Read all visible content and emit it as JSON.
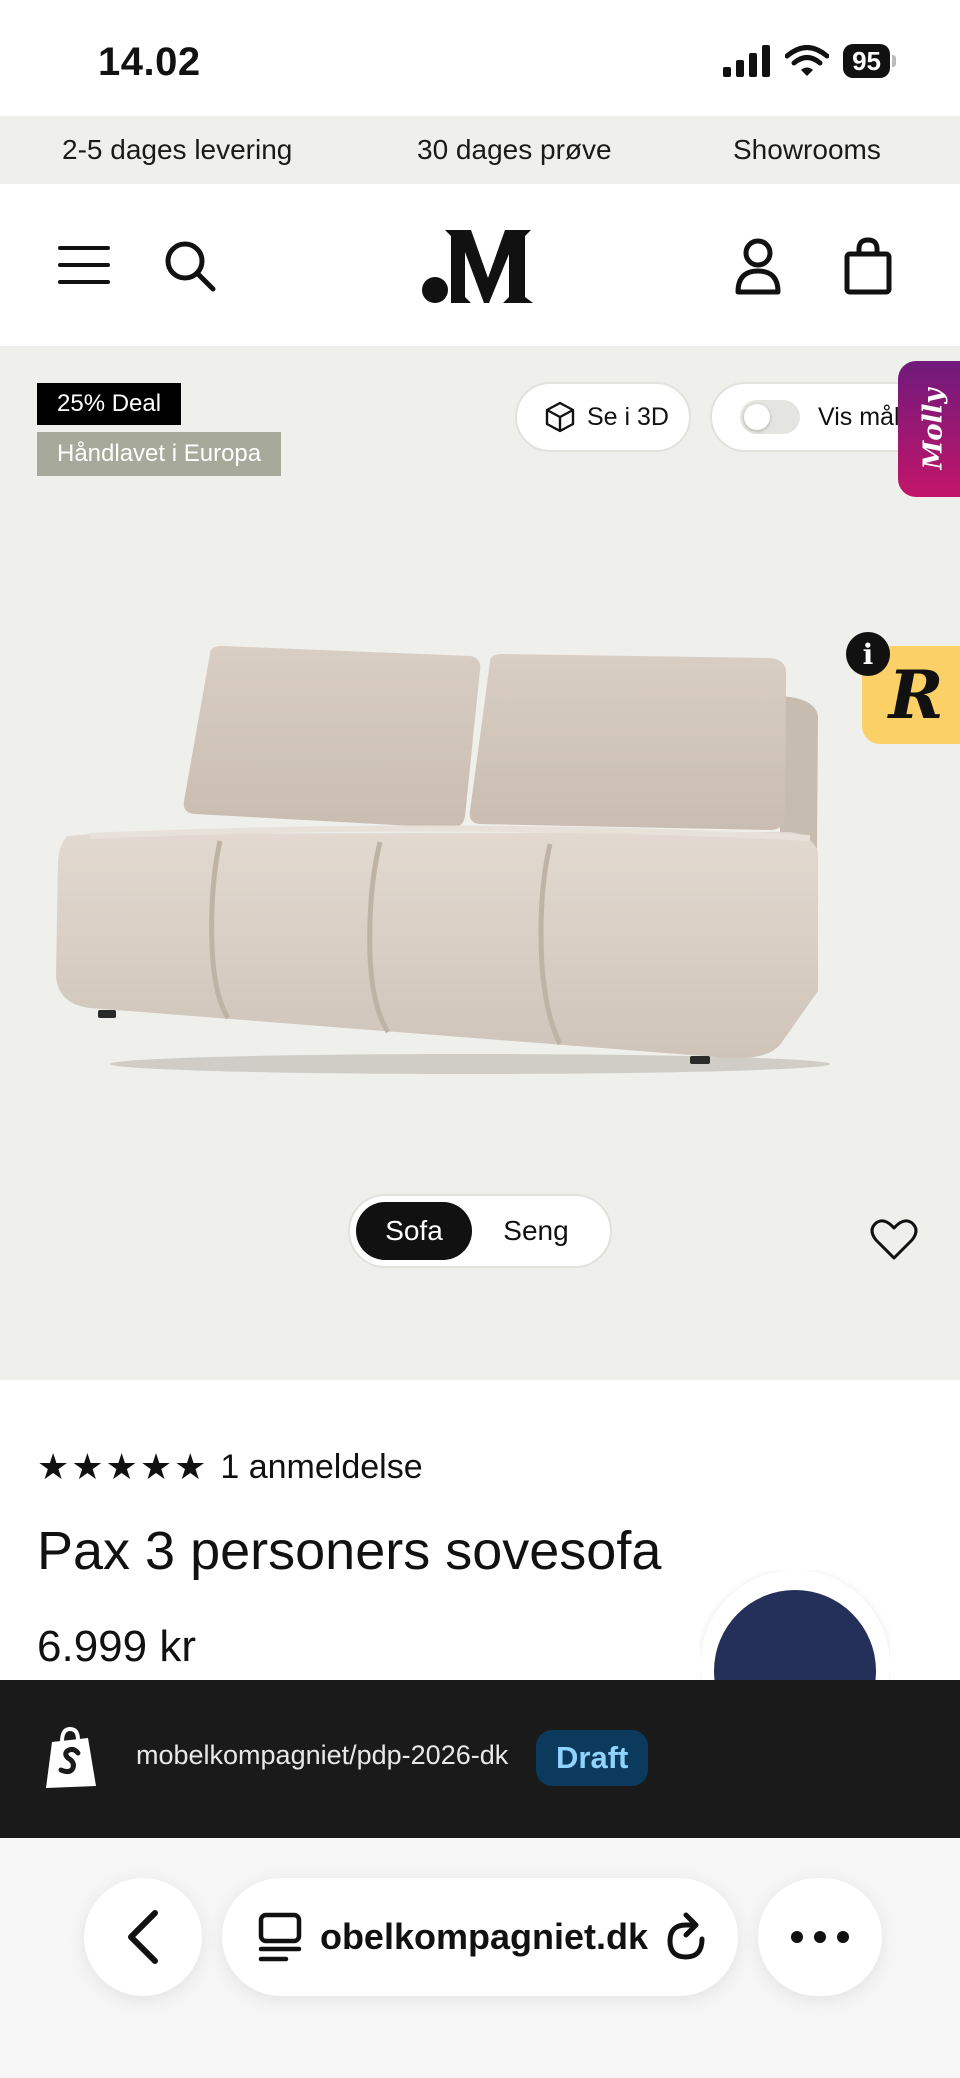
{
  "status_bar": {
    "time": "14.02",
    "battery": "95"
  },
  "announcement": {
    "items": [
      "2-5 dages levering",
      "30 dages prøve",
      "Showrooms"
    ]
  },
  "header": {
    "logo": ".M"
  },
  "gallery": {
    "badges": {
      "deal": "25% Deal",
      "origin": "Håndlavet i Europa"
    },
    "view_3d_label": "Se i 3D",
    "show_measurements_label": "Vis mål",
    "molly_label": "Molly",
    "r_widget_label": "R",
    "info_label": "i",
    "variant_tabs": [
      {
        "label": "Sofa",
        "active": true
      },
      {
        "label": "Seng",
        "active": false
      }
    ],
    "sofa_color": "#dcd2c9"
  },
  "product": {
    "stars": "★★★★★",
    "review_count_label": "1 anmeldelse",
    "title": "Pax 3 personers sovesofa",
    "price": "6.999 kr"
  },
  "preview_bar": {
    "store_path": "mobelkompagniet/pdp-2026-dk",
    "status_badge": "Draft"
  },
  "browser": {
    "url_display": "mobelkompagniet.dk"
  },
  "colors": {
    "announcement_bg": "#efefeb",
    "gallery_bg": "#efefec",
    "badge_deal_bg": "#000000",
    "badge_origin_bg": "#a7a99b",
    "draft_bg": "#0b3a5c",
    "draft_text": "#8fd3ff",
    "preview_bg": "#1a1a1a"
  }
}
